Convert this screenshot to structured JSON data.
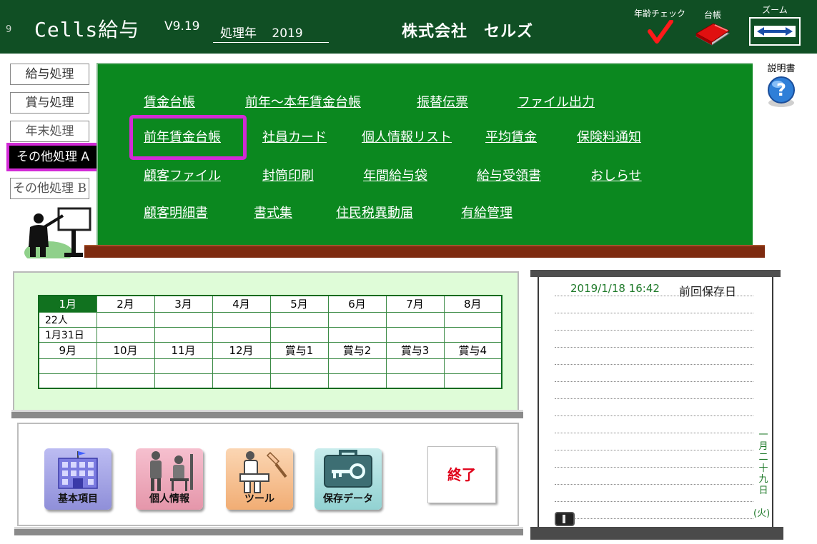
{
  "header": {
    "sheet_number": "9",
    "app_title": "Cells給与",
    "version": "V9.19",
    "year_label": "処理年",
    "year_value": "2019",
    "company": "株式会社　セルズ",
    "tools": {
      "age_check_label": "年齢チェック",
      "ledger_label": "台帳",
      "zoom_label": "ズーム"
    }
  },
  "nav": {
    "items": [
      {
        "label": "給与処理"
      },
      {
        "label": "賞与処理"
      },
      {
        "label": "年末処理"
      },
      {
        "label": "その他処理 A"
      },
      {
        "label": "その他処理 B"
      }
    ],
    "active_index": 3
  },
  "menu": {
    "row1": [
      "賃金台帳",
      "前年～本年賃金台帳",
      "振替伝票",
      "ファイル出力"
    ],
    "row2": [
      "前年賃金台帳",
      "社員カード",
      "個人情報リスト",
      "平均賃金",
      "保険料通知"
    ],
    "row3": [
      "顧客ファイル",
      "封筒印刷",
      "年間給与袋",
      "給与受領書",
      "おしらせ"
    ],
    "row4": [
      "顧客明細書",
      "書式集",
      "住民税異動届",
      "有給管理"
    ],
    "highlighted": "前年賃金台帳"
  },
  "help": {
    "label": "説明書"
  },
  "calendar": {
    "months_row1": [
      "1月",
      "2月",
      "3月",
      "4月",
      "5月",
      "6月",
      "7月",
      "8月"
    ],
    "months_row2": [
      "9月",
      "10月",
      "11月",
      "12月",
      "賞与1",
      "賞与2",
      "賞与3",
      "賞与4"
    ],
    "selected_month": "1月",
    "jan_count": "22人",
    "jan_date": "1月31日"
  },
  "tools": {
    "basic": "基本項目",
    "personal": "個人情報",
    "tool": "ツール",
    "saved": "保存データ",
    "exit": "終了"
  },
  "notepad": {
    "last_saved_datetime": "2019/1/18 16:42",
    "last_saved_label": "前回保存日",
    "vertical_date": "一月二十九日",
    "weekday": "(火)"
  },
  "colors": {
    "header_bg": "#104f24",
    "board_green": "#0b881f",
    "highlight_magenta": "#d22ad6",
    "ledge_brown": "#7e2b10",
    "exit_red": "#e0001a"
  }
}
